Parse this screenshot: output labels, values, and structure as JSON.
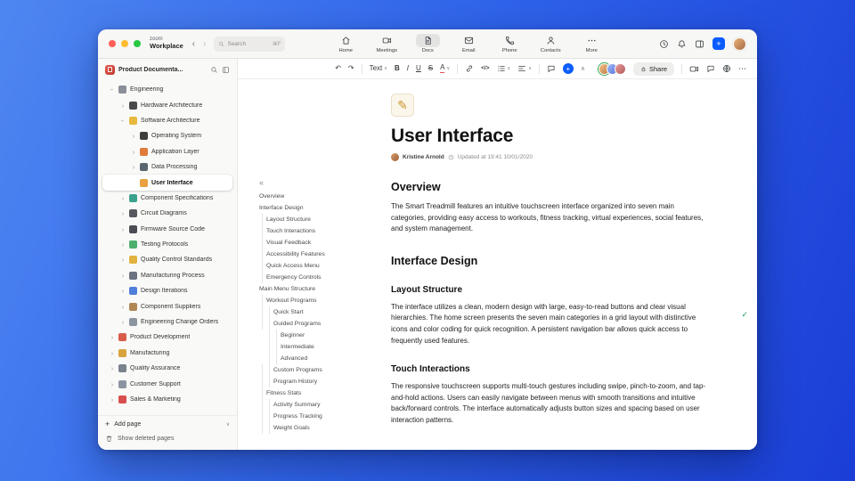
{
  "header": {
    "brand": {
      "top": "zoom",
      "bottom": "Workplace"
    },
    "search": {
      "placeholder": "Search",
      "shortcut": "⌘F"
    },
    "tabs": [
      {
        "label": "Home",
        "icon": "home-icon",
        "active": false
      },
      {
        "label": "Meetings",
        "icon": "meetings-icon",
        "active": false
      },
      {
        "label": "Docs",
        "icon": "docs-icon",
        "active": true
      },
      {
        "label": "Email",
        "icon": "email-icon",
        "active": false
      },
      {
        "label": "Phone",
        "icon": "phone-icon",
        "active": false
      },
      {
        "label": "Contacts",
        "icon": "contacts-icon",
        "active": false
      },
      {
        "label": "More",
        "icon": "more-icon",
        "active": false
      }
    ]
  },
  "glyphs": {
    "undo": "↶",
    "redo": "↷",
    "caret_down": "∨",
    "caret_up": "∧",
    "chevron_right": "›",
    "chevron_back": "‹",
    "chevron_forward": "›",
    "collapse": "«",
    "plus": "+",
    "more_h": "⋯",
    "check": "✓",
    "pencil": "✎"
  },
  "sidebar": {
    "workspace_title": "Product Documenta...",
    "add_page_label": "Add page",
    "show_deleted_label": "Show deleted pages",
    "items": [
      {
        "label": "Engineering",
        "depth": 0,
        "icon": "gear-icon",
        "color": "#8a8f98",
        "expanded": true
      },
      {
        "label": "Hardware Architecture",
        "depth": 1,
        "icon": "hardware-icon",
        "color": "#4a4a4a"
      },
      {
        "label": "Software Architecture",
        "depth": 1,
        "icon": "software-icon",
        "color": "#e8b93e",
        "expanded": true
      },
      {
        "label": "Operating System",
        "depth": 2,
        "icon": "operating-system-icon",
        "color": "#3d3d3d"
      },
      {
        "label": "Application Layer",
        "depth": 2,
        "icon": "application-layer-icon",
        "color": "#e07b39"
      },
      {
        "label": "Data Processing",
        "depth": 2,
        "icon": "data-processing-icon",
        "color": "#5b6770"
      },
      {
        "label": "User Interface",
        "depth": 2,
        "icon": "user-interface-icon",
        "color": "#e8a13e",
        "selected": true,
        "chevron": false
      },
      {
        "label": "Component Specifications",
        "depth": 1,
        "icon": "components-icon",
        "color": "#3ba18f"
      },
      {
        "label": "Circuit Diagrams",
        "depth": 1,
        "icon": "circuit-icon",
        "color": "#55595f"
      },
      {
        "label": "Firmware Source Code",
        "depth": 1,
        "icon": "firmware-icon",
        "color": "#4a4e54"
      },
      {
        "label": "Testing Protocols",
        "depth": 1,
        "icon": "testing-icon",
        "color": "#4caf6e"
      },
      {
        "label": "Quality Control Standards",
        "depth": 1,
        "icon": "quality-standards-icon",
        "color": "#e3b341"
      },
      {
        "label": "Manufacturing Process",
        "depth": 1,
        "icon": "process-icon",
        "color": "#6b7280"
      },
      {
        "label": "Design Iterations",
        "depth": 1,
        "icon": "design-icon",
        "color": "#4f7fd9"
      },
      {
        "label": "Component Suppliers",
        "depth": 1,
        "icon": "suppliers-icon",
        "color": "#b08653"
      },
      {
        "label": "Engineering Change Orders",
        "depth": 1,
        "icon": "change-orders-icon",
        "color": "#8b95a1"
      },
      {
        "label": "Product Development",
        "depth": 0,
        "icon": "rocket-icon",
        "color": "#d95c4a"
      },
      {
        "label": "Manufacturing",
        "depth": 0,
        "icon": "factory-icon",
        "color": "#d9a43e"
      },
      {
        "label": "Quality Assurance",
        "depth": 0,
        "icon": "qa-icon",
        "color": "#7a828c"
      },
      {
        "label": "Customer Support",
        "depth": 0,
        "icon": "support-icon",
        "color": "#8c94a0"
      },
      {
        "label": "Sales & Marketing",
        "depth": 0,
        "icon": "sales-icon",
        "color": "#d94f4f"
      }
    ]
  },
  "doc_toolbar": {
    "style_label": "Text",
    "bold_label": "B",
    "italic_label": "I",
    "underline_label": "U",
    "strike_label": "S",
    "color_label": "A",
    "code_label": "</>",
    "share_label": "Share"
  },
  "toc": {
    "items": [
      {
        "label": "Overview",
        "depth": 0
      },
      {
        "label": "Interface Design",
        "depth": 0
      },
      {
        "label": "Layout Structure",
        "depth": 1
      },
      {
        "label": "Touch Interactions",
        "depth": 1
      },
      {
        "label": "Visual Feedback",
        "depth": 1
      },
      {
        "label": "Accessibility Features",
        "depth": 1
      },
      {
        "label": "Quick Access Menu",
        "depth": 1
      },
      {
        "label": "Emergency Controls",
        "depth": 1
      },
      {
        "label": "Main Menu Structure",
        "depth": 0
      },
      {
        "label": "Workout Programs",
        "depth": 1
      },
      {
        "label": "Quick Start",
        "depth": 2
      },
      {
        "label": "Guided Programs",
        "depth": 2
      },
      {
        "label": "Beginner",
        "depth": 3
      },
      {
        "label": "Intermediate",
        "depth": 3
      },
      {
        "label": "Advanced",
        "depth": 3
      },
      {
        "label": "Custom Programs",
        "depth": 2
      },
      {
        "label": "Program History",
        "depth": 2
      },
      {
        "label": "Fitness Stats",
        "depth": 1
      },
      {
        "label": "Activity Summary",
        "depth": 2
      },
      {
        "label": "Progress Tracking",
        "depth": 2
      },
      {
        "label": "Weight Goals",
        "depth": 2
      }
    ]
  },
  "doc": {
    "title": "User Interface",
    "author": "Kristine Arnold",
    "updated": "Updated at 19:41 10/01/2020",
    "sections": [
      {
        "level": 2,
        "heading": "Overview",
        "text": "The Smart Treadmill features an intuitive touchscreen interface organized into seven main categories, providing easy access to workouts, fitness tracking, virtual experiences, social features, and system management."
      },
      {
        "level": 2,
        "heading": "Interface Design",
        "text": ""
      },
      {
        "level": 3,
        "heading": "Layout Structure",
        "text": "The interface utilizes a clean, modern design with large, easy-to-read buttons and clear visual hierarchies. The home screen presents the seven main categories in a grid layout with distinctive icons and color coding for quick recognition. A persistent navigation bar allows quick access to frequently used features."
      },
      {
        "level": 3,
        "heading": "Touch Interactions",
        "text": "The responsive touchscreen supports multi-touch gestures including swipe, pinch-to-zoom, and tap-and-hold actions. Users can easily navigate between menus with smooth transitions and intuitive back/forward controls. The interface automatically adjusts button sizes and spacing based on user interaction patterns."
      }
    ]
  },
  "colors": {
    "accent": "#0b5cff",
    "success_check": "#1ea05a"
  }
}
